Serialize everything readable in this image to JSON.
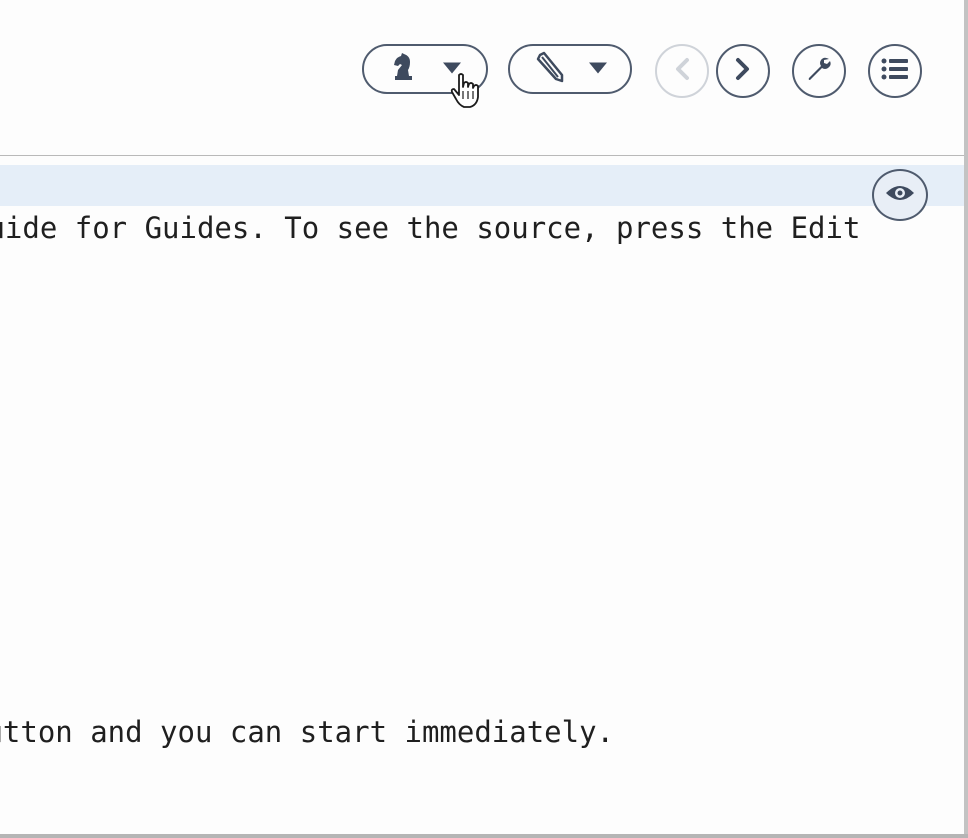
{
  "toolbar": {
    "buttons": [
      {
        "name": "chess-knight-dropdown",
        "icon": "chess-knight-icon"
      },
      {
        "name": "pencil-dropdown",
        "icon": "pencil-icon"
      },
      {
        "name": "back-button",
        "icon": "chevron-left-icon",
        "disabled": true
      },
      {
        "name": "forward-button",
        "icon": "chevron-right-icon"
      },
      {
        "name": "settings-button",
        "icon": "wrench-icon"
      },
      {
        "name": "menu-button",
        "icon": "list-icon"
      }
    ]
  },
  "content": {
    "line1": "Guide for Guides. To see the source, press the Edit",
    "line2": "button and you can start immediately."
  },
  "colors": {
    "icon": "#3e4a5e",
    "border": "#4f5b6e",
    "disabled": "#cfd3d9",
    "highlight": "#e5eef8"
  }
}
